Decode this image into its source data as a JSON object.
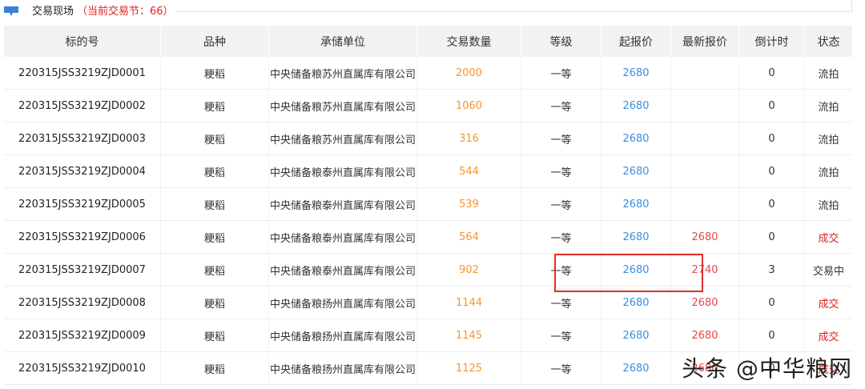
{
  "header": {
    "title": "交易现场",
    "session_text": "（当前交易节：66）"
  },
  "table": {
    "columns": [
      "标的号",
      "品种",
      "承储单位",
      "交易数量",
      "等级",
      "起报价",
      "最新报价",
      "倒计时",
      "状态"
    ],
    "rows": [
      {
        "id": "220315JSS3219ZJD0001",
        "variety": "粳稻",
        "unit": "中央储备粮苏州直属库有限公司",
        "qty": "2000",
        "grade": "一等",
        "start": "2680",
        "latest": "",
        "countdown": "0",
        "status": "流拍"
      },
      {
        "id": "220315JSS3219ZJD0002",
        "variety": "粳稻",
        "unit": "中央储备粮苏州直属库有限公司",
        "qty": "1060",
        "grade": "一等",
        "start": "2680",
        "latest": "",
        "countdown": "0",
        "status": "流拍"
      },
      {
        "id": "220315JSS3219ZJD0003",
        "variety": "粳稻",
        "unit": "中央储备粮苏州直属库有限公司",
        "qty": "316",
        "grade": "一等",
        "start": "2680",
        "latest": "",
        "countdown": "0",
        "status": "流拍"
      },
      {
        "id": "220315JSS3219ZJD0004",
        "variety": "粳稻",
        "unit": "中央储备粮泰州直属库有限公司",
        "qty": "544",
        "grade": "一等",
        "start": "2680",
        "latest": "",
        "countdown": "0",
        "status": "流拍"
      },
      {
        "id": "220315JSS3219ZJD0005",
        "variety": "粳稻",
        "unit": "中央储备粮泰州直属库有限公司",
        "qty": "539",
        "grade": "一等",
        "start": "2680",
        "latest": "",
        "countdown": "0",
        "status": "流拍"
      },
      {
        "id": "220315JSS3219ZJD0006",
        "variety": "粳稻",
        "unit": "中央储备粮泰州直属库有限公司",
        "qty": "564",
        "grade": "一等",
        "start": "2680",
        "latest": "2680",
        "countdown": "0",
        "status": "成交"
      },
      {
        "id": "220315JSS3219ZJD0007",
        "variety": "粳稻",
        "unit": "中央储备粮泰州直属库有限公司",
        "qty": "902",
        "grade": "一等",
        "start": "2680",
        "latest": "2740",
        "countdown": "3",
        "status": "交易中"
      },
      {
        "id": "220315JSS3219ZJD0008",
        "variety": "粳稻",
        "unit": "中央储备粮扬州直属库有限公司",
        "qty": "1144",
        "grade": "一等",
        "start": "2680",
        "latest": "2680",
        "countdown": "0",
        "status": "成交"
      },
      {
        "id": "220315JSS3219ZJD0009",
        "variety": "粳稻",
        "unit": "中央储备粮扬州直属库有限公司",
        "qty": "1145",
        "grade": "一等",
        "start": "2680",
        "latest": "2680",
        "countdown": "0",
        "status": "成交"
      },
      {
        "id": "220315JSS3219ZJD0010",
        "variety": "粳稻",
        "unit": "中央储备粮扬州直属库有限公司",
        "qty": "1125",
        "grade": "一等",
        "start": "2680",
        "latest": "2680",
        "countdown": "0",
        "status": "成交"
      }
    ]
  },
  "watermark": "头条 @中华粮网",
  "colors": {
    "quantity": "#f5962a",
    "start_price": "#3a8fdc",
    "latest_price": "#e54848",
    "status_deal": "#e02020",
    "highlight": "#e0302a",
    "header_bg": "#f2f2f2"
  }
}
